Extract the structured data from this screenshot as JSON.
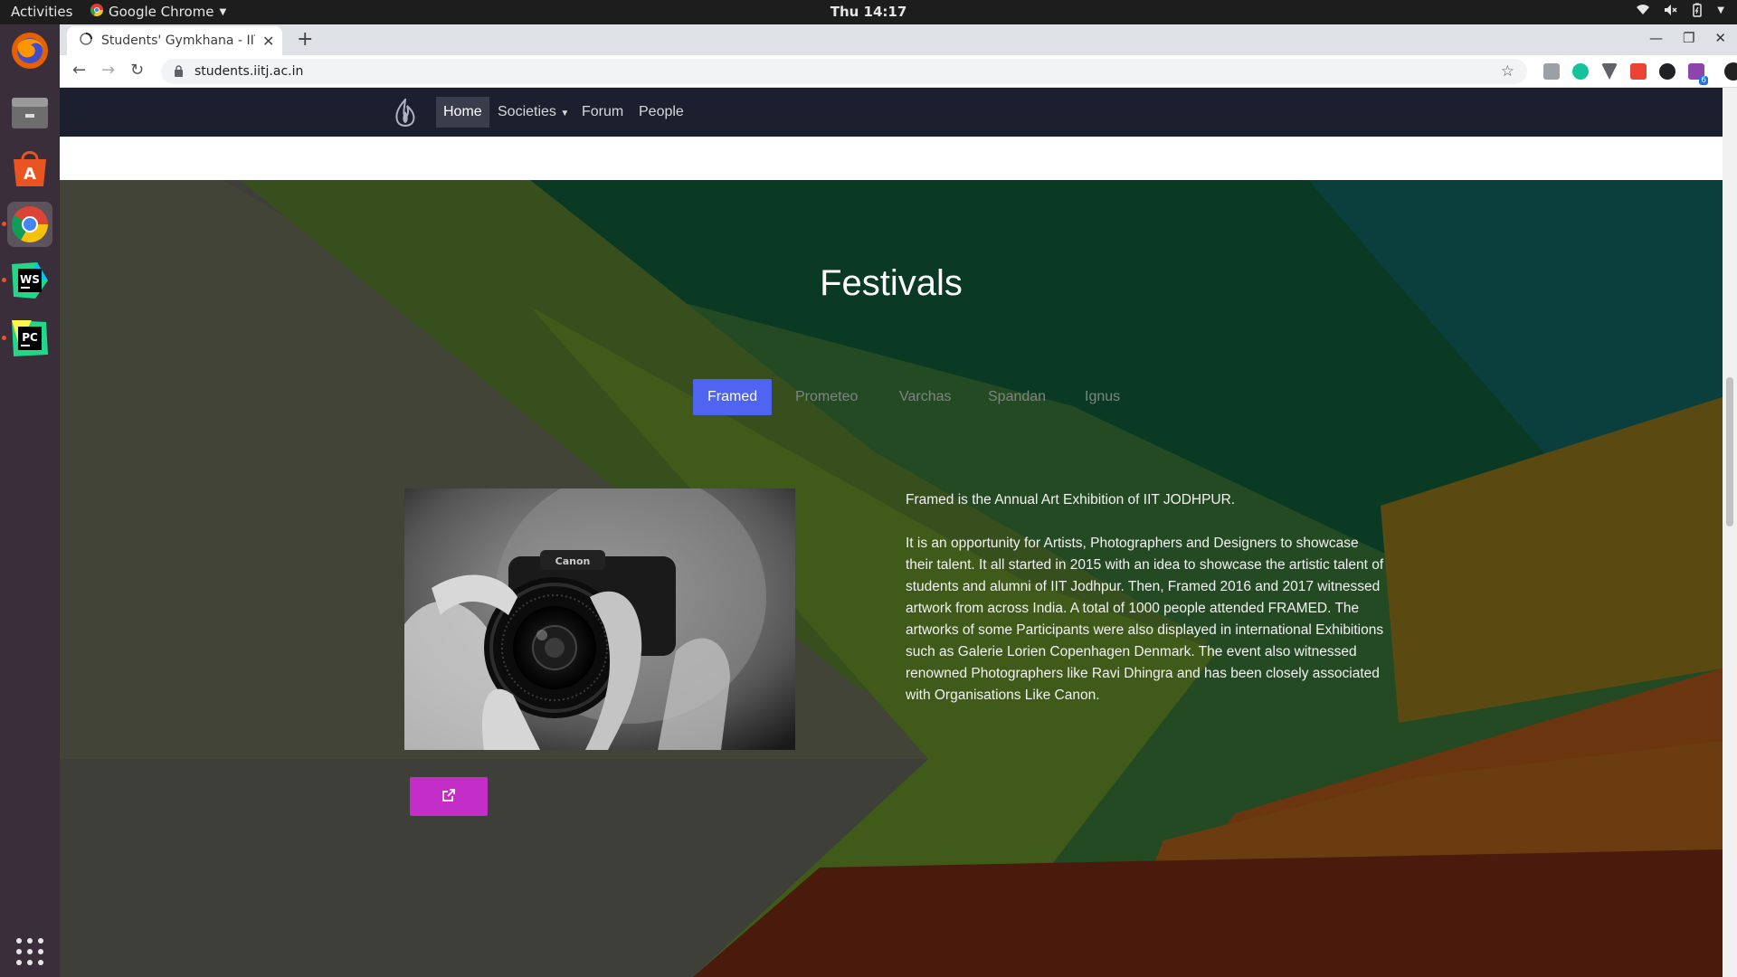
{
  "system": {
    "activities": "Activities",
    "app_menu": "Google Chrome",
    "clock": "Thu 14:17"
  },
  "dock": {
    "items": [
      "firefox-icon",
      "files-icon",
      "software-icon",
      "chrome-icon",
      "webstorm-icon",
      "pycharm-icon",
      "app-grid-icon"
    ]
  },
  "browser": {
    "tab_title": "Students' Gymkhana - IIT",
    "url": "students.iitj.ac.in",
    "extension_badge": "6"
  },
  "site": {
    "nav": {
      "home": "Home",
      "societies": "Societies",
      "forum": "Forum",
      "people": "People"
    },
    "section_title": "Festivals",
    "tabs": [
      "Framed",
      "Prometeo",
      "Varchas",
      "Spandan",
      "Ignus"
    ],
    "active_tab": "Framed",
    "description_1": "Framed is the Annual Art Exhibition of IIT JODHPUR.",
    "description_2": "It is an opportunity for Artists, Photographers and Designers to showcase their talent. It all started in 2015 with an idea to showcase the artistic talent of students and alumni of IIT Jodhpur. Then, Framed 2016 and 2017 witnessed artwork from across India. A total of 1000 people attended FRAMED. The artworks of some Participants were also displayed in international Exhibitions such as Galerie Lorien Copenhagen Denmark. The event also witnessed renowned Photographers like Ravi Dhingra and has been closely associated with Organisations Like Canon.",
    "camera_brand": "Canon",
    "lens_text": "CANON ZOOM LENS EF-S 18-55mm 1:3.5-5.6 II"
  },
  "colors": {
    "nav_bg": "#1b1f2e",
    "active_tab": "#4f64f0",
    "external_button": "#c32ec8"
  }
}
